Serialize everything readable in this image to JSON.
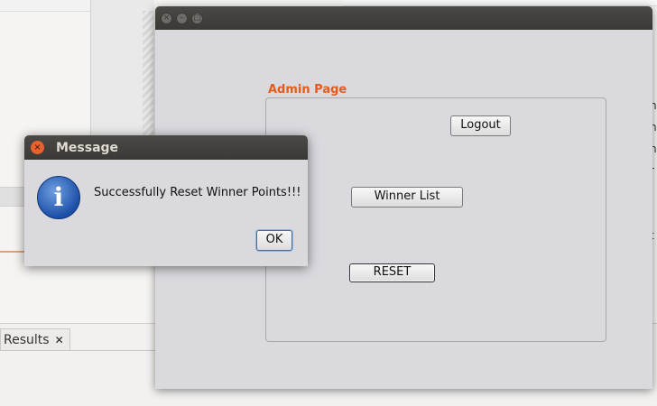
{
  "background": {
    "results_tab_label": "Results",
    "results_tab_close": "✕",
    "edge_glyphs": [
      "n",
      "n",
      "n",
      "r",
      "",
      "",
      "t"
    ]
  },
  "main_window": {
    "admin_label": "Admin Page",
    "buttons": {
      "logout": "Logout",
      "winner_list": "Winner List",
      "reset": "RESET"
    },
    "titlebar_buttons": [
      "close",
      "minimize",
      "maximize"
    ]
  },
  "dialog": {
    "title": "Message",
    "message": "Successfully Reset Winner Points!!!",
    "ok_label": "OK",
    "icon": "info-icon"
  },
  "colors": {
    "accent_orange": "#e55c1a",
    "titlebar": "#3c3b37",
    "window_bg": "#d9d9de"
  }
}
